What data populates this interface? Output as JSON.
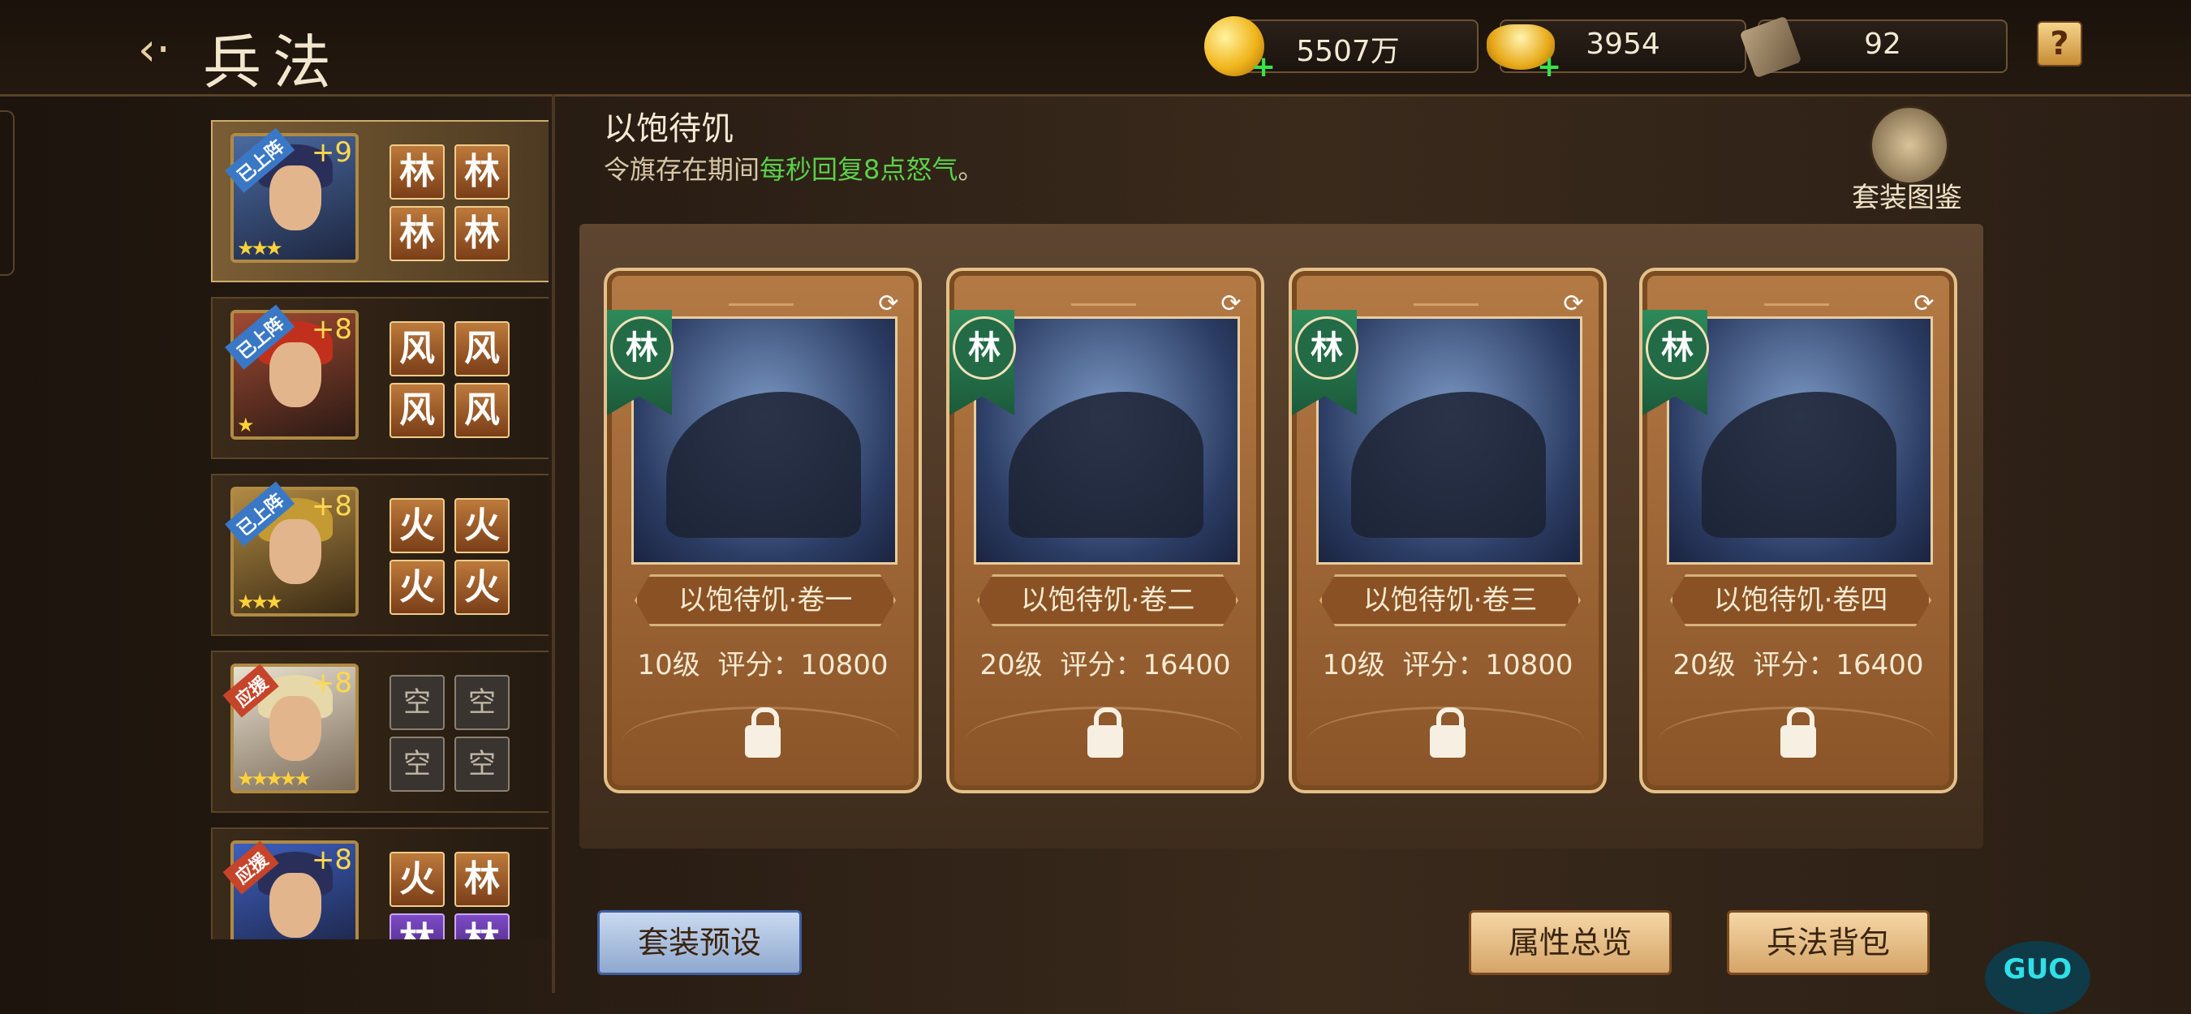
{
  "header": {
    "back_icon": "back-arrow-icon",
    "title": "兵法",
    "resources": [
      {
        "icon": "gold-coin-icon",
        "value": "5507万"
      },
      {
        "icon": "gold-ingot-icon",
        "value": "3954"
      },
      {
        "icon": "scroll-icon",
        "value": "92"
      }
    ],
    "help": "?"
  },
  "heroes": [
    {
      "badge": "已上阵",
      "level": "+9",
      "stars": "★★★",
      "slots": [
        "林",
        "林",
        "林",
        "林"
      ],
      "selected": true
    },
    {
      "badge": "已上阵",
      "level": "+8",
      "stars": "★",
      "slots": [
        "风",
        "风",
        "风",
        "风"
      ]
    },
    {
      "badge": "已上阵",
      "level": "+8",
      "stars": "★★★",
      "slots": [
        "火",
        "火",
        "火",
        "火"
      ]
    },
    {
      "badge": "应援",
      "level": "+8",
      "stars": "★★★★★",
      "slots": [
        "空",
        "空",
        "空",
        "空"
      ]
    },
    {
      "badge": "应援",
      "level": "+8",
      "stars": "",
      "slots": [
        "火",
        "林",
        "林",
        "林"
      ]
    }
  ],
  "set": {
    "name": "以饱待饥",
    "desc_prefix": "令旗存在期间",
    "desc_highlight": "每秒回复8点怒气",
    "desc_suffix": "。",
    "atlas_label": "套装图鉴"
  },
  "cards": [
    {
      "tag": "林",
      "name": "以饱待饥·卷一",
      "level": "10级",
      "score_label": "评分：",
      "score": "10800"
    },
    {
      "tag": "林",
      "name": "以饱待饥·卷二",
      "level": "20级",
      "score_label": "评分：",
      "score": "16400"
    },
    {
      "tag": "林",
      "name": "以饱待饥·卷三",
      "level": "10级",
      "score_label": "评分：",
      "score": "10800"
    },
    {
      "tag": "林",
      "name": "以饱待饥·卷四",
      "level": "20级",
      "score_label": "评分：",
      "score": "16400"
    }
  ],
  "buttons": {
    "preset": "套装预设",
    "attributes": "属性总览",
    "bag": "兵法背包"
  },
  "logo": "GUO"
}
